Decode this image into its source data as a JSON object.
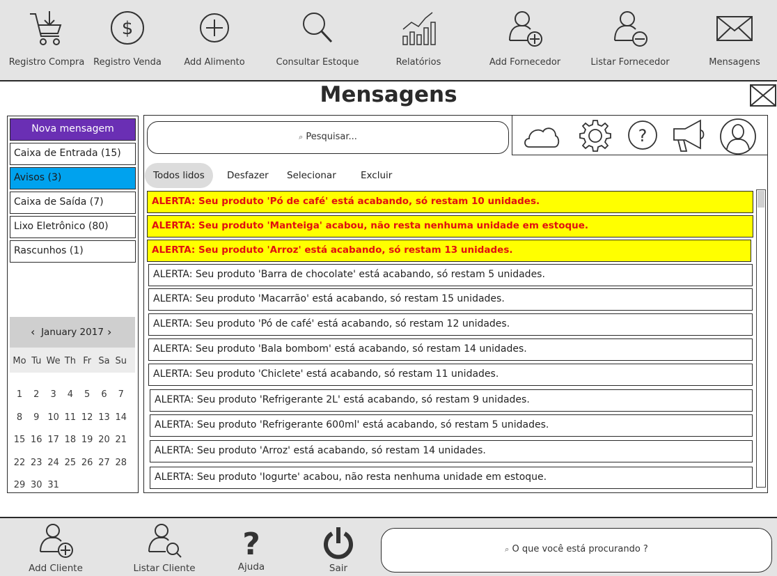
{
  "toolbar": [
    {
      "label": "Registro Compra",
      "icon": "cart-icon"
    },
    {
      "label": "Registro Venda",
      "icon": "dollar-icon"
    },
    {
      "label": "Add Alimento",
      "icon": "plus-circle-icon"
    },
    {
      "label": "Consultar Estoque",
      "icon": "search-icon"
    },
    {
      "label": "Relatórios",
      "icon": "chart-icon"
    },
    {
      "label": "Add Fornecedor",
      "icon": "user-plus-icon"
    },
    {
      "label": "Listar Fornecedor",
      "icon": "user-minus-icon"
    },
    {
      "label": "Mensagens",
      "icon": "envelope-icon"
    }
  ],
  "page": {
    "title": "Mensagens"
  },
  "sidebar": {
    "new_message": "Nova mensagem",
    "folders": [
      {
        "label": "Caixa de Entrada (15)"
      },
      {
        "label": "Avisos (3)"
      },
      {
        "label": "Caixa de Saída (7)"
      },
      {
        "label": "Lixo Eletrônico (80)"
      },
      {
        "label": "Rascunhos (1)"
      }
    ],
    "active_folder": "Avisos (3)"
  },
  "calendar": {
    "month_label": "January 2017",
    "prev": "‹",
    "next": "›",
    "weekdays": [
      "Mo",
      "Tu",
      "We",
      "Th",
      "Fr",
      "Sa",
      "Su"
    ],
    "weeks": [
      [
        "1",
        "2",
        "3",
        "4",
        "5",
        "6",
        "7"
      ],
      [
        "8",
        "9",
        "10",
        "11",
        "12",
        "13",
        "14"
      ],
      [
        "15",
        "16",
        "17",
        "18",
        "19",
        "20",
        "21"
      ],
      [
        "22",
        "23",
        "24",
        "25",
        "26",
        "27",
        "28"
      ],
      [
        "29",
        "30",
        "31",
        "",
        "",
        "",
        ""
      ]
    ]
  },
  "main": {
    "search_placeholder": "Pesquisar...",
    "search_glyph": "🔍",
    "icons": [
      "cloud-icon",
      "settings-icon",
      "help-icon",
      "megaphone-icon",
      "profile-icon"
    ],
    "actions": [
      "Todos lidos",
      "Desfazer",
      "Selecionar",
      "Excluir"
    ],
    "selected_action": "Todos lidos",
    "messages": [
      {
        "text": "ALERTA: Seu produto 'Pó de café' está acabando, só restam 10 unidades.",
        "alert": true
      },
      {
        "text": "ALERTA: Seu produto 'Manteiga' acabou, não resta nenhuma unidade em estoque.",
        "alert": true
      },
      {
        "text": "ALERTA: Seu produto 'Arroz' está acabando, só restam 13 unidades.",
        "alert": true
      },
      {
        "text": "ALERTA: Seu produto 'Barra de chocolate' está acabando, só restam 5 unidades.",
        "alert": false
      },
      {
        "text": "ALERTA: Seu produto 'Macarrão' está acabando, só restam 15 unidades.",
        "alert": false
      },
      {
        "text": "ALERTA: Seu produto 'Pó de café' está acabando, só restam 12 unidades.",
        "alert": false
      },
      {
        "text": "ALERTA: Seu produto 'Bala bombom' está acabando, só restam 14 unidades.",
        "alert": false
      },
      {
        "text": "ALERTA: Seu produto 'Chiclete' está acabando, só restam 11 unidades.",
        "alert": false
      },
      {
        "text": "ALERTA: Seu produto 'Refrigerante 2L' está acabando, só restam 9 unidades.",
        "alert": false
      },
      {
        "text": "ALERTA: Seu produto 'Refrigerante 600ml' está acabando, só restam 5 unidades.",
        "alert": false
      },
      {
        "text": "ALERTA: Seu produto 'Arroz' está acabando, só restam 14 unidades.",
        "alert": false
      },
      {
        "text": "ALERTA: Seu produto 'Iogurte' acabou, não resta nenhuma unidade em estoque.",
        "alert": false
      }
    ]
  },
  "bottombar": {
    "items": [
      {
        "label": "Add Cliente",
        "icon": "user-plus-icon"
      },
      {
        "label": "Listar Cliente",
        "icon": "user-search-icon"
      },
      {
        "label": "Ajuda",
        "icon": "question-icon"
      },
      {
        "label": "Sair",
        "icon": "power-icon"
      }
    ],
    "search_placeholder": "O que você está procurando ?"
  },
  "colors": {
    "toolbar_bg": "#e4e4e4",
    "new_message_bg": "#6a2fb4",
    "active_folder_bg": "#00a2ee",
    "alert_bg": "#ffff00",
    "alert_text": "#e01010"
  }
}
